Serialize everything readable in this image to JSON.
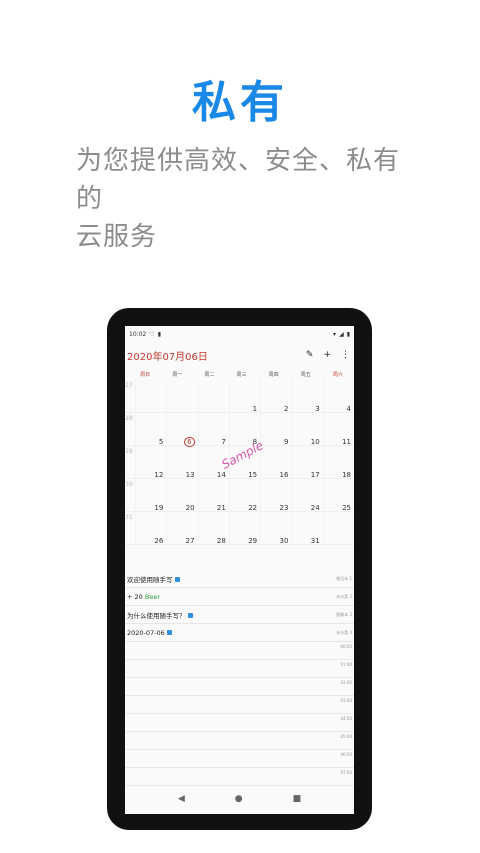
{
  "promo": {
    "headline": "私有",
    "line1": "为您提供高效、安全、私有的",
    "line2": "云服务"
  },
  "status_bar": {
    "time": "10:02",
    "icons": [
      "heart-icon",
      "sd-card-icon"
    ],
    "right_icons": [
      "wifi-icon",
      "signal-icon",
      "battery-icon"
    ]
  },
  "toolbar": {
    "title": "2020年07月06日",
    "actions": [
      "edit-icon",
      "add-icon",
      "more-icon"
    ]
  },
  "calendar": {
    "weekdays": [
      "周日",
      "周一",
      "周二",
      "周三",
      "周四",
      "周五",
      "周六"
    ],
    "weeks": [
      {
        "num": "27",
        "days": [
          "",
          "",
          "",
          "1",
          "2",
          "3",
          "4"
        ]
      },
      {
        "num": "28",
        "days": [
          "5",
          "6",
          "7",
          "8",
          "9",
          "10",
          "11"
        ]
      },
      {
        "num": "29",
        "days": [
          "12",
          "13",
          "14",
          "15",
          "16",
          "17",
          "18"
        ]
      },
      {
        "num": "30",
        "days": [
          "19",
          "20",
          "21",
          "22",
          "23",
          "24",
          "25"
        ]
      },
      {
        "num": "31",
        "days": [
          "26",
          "27",
          "28",
          "29",
          "30",
          "31",
          ""
        ]
      }
    ],
    "today": "6",
    "watermark": "Sample"
  },
  "list": [
    {
      "text": "欢迎使用随手写",
      "meta": "笔记本 1",
      "badge": true
    },
    {
      "text": "+      20 ",
      "extra": "Beer",
      "meta": "未分类 2",
      "badge": false
    },
    {
      "text": "为什么使用随手写？",
      "meta": "图解本 3",
      "badge": true
    },
    {
      "text": "2020-07-06",
      "meta": "未分类 4",
      "badge": true
    }
  ],
  "timeline": [
    "00:00",
    "01:00",
    "02:00",
    "03:00",
    "04:00",
    "05:00",
    "06:00",
    "07:00"
  ],
  "nav": [
    "◀",
    "●",
    "■"
  ]
}
